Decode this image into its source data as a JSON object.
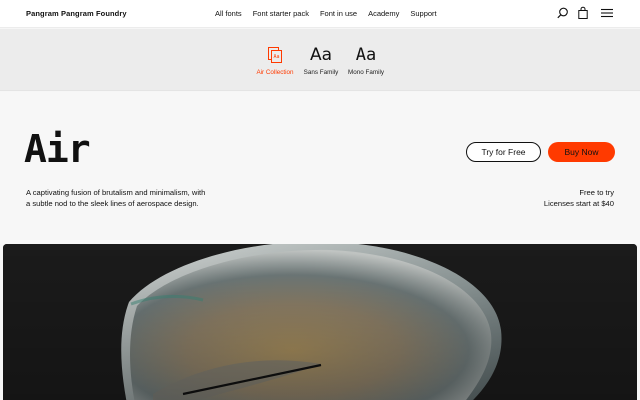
{
  "header": {
    "brand": "Pangram Pangram Foundry",
    "nav": [
      "All fonts",
      "Font starter pack",
      "Font in use",
      "Academy",
      "Support"
    ],
    "icons": [
      "search-icon",
      "shopping-bag-icon",
      "menu-icon"
    ]
  },
  "tabs": [
    {
      "label": "Air Collection",
      "icon": "air-collection-icon",
      "active": true
    },
    {
      "label": "Sans Family",
      "sample": "Aa",
      "active": false
    },
    {
      "label": "Mono Family",
      "sample": "Aa",
      "active": false
    }
  ],
  "hero": {
    "title": "Air",
    "description_line1": "A captivating fusion of brutalism and minimalism, with",
    "description_line2": "a subtle nod to the sleek lines of aerospace design.",
    "try_button": "Try for Free",
    "buy_button": "Buy Now",
    "pricing_line1": "Free to try",
    "pricing_line2": "Licenses start at $40"
  },
  "colors": {
    "accent": "#ff3a00",
    "media_background": "#1b1b1b"
  }
}
